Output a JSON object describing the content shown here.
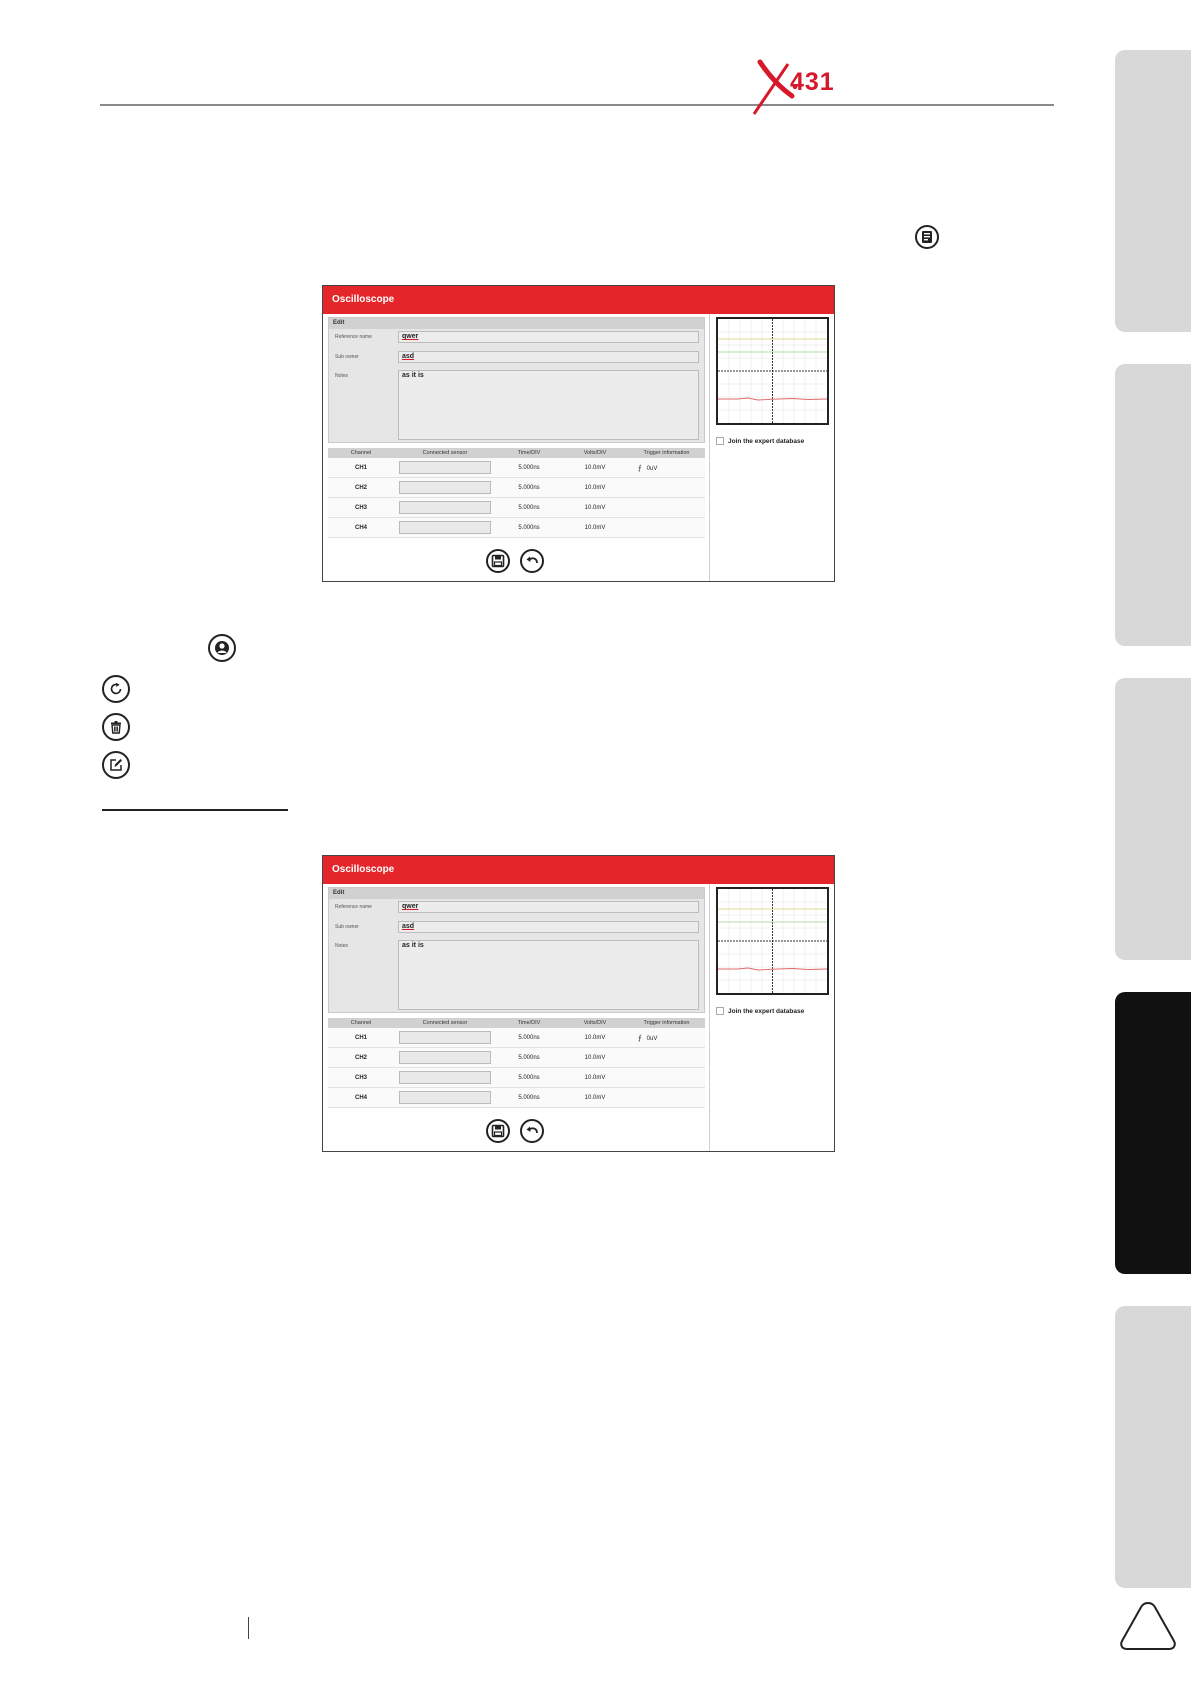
{
  "brand": {
    "logo_text": "431",
    "accent_color": "#d7182a"
  },
  "icons": {
    "header_icon": "notes-icon",
    "user_icon": "user-icon",
    "refresh_icon": "refresh-icon",
    "delete_icon": "trash-icon",
    "edit_icon": "edit-icon"
  },
  "screens": [
    {
      "title": "Oscilloscope",
      "edit": {
        "title": "Edit",
        "reference_name_label": "Reference name",
        "reference_name_value": "qwer",
        "sub_owner_label": "Sub owner",
        "sub_owner_value": "asd",
        "notes_label": "Notes",
        "notes_value": "as it is"
      },
      "table": {
        "headers": [
          "Channel",
          "Connected sensor",
          "Time/DIV",
          "Volts/DIV",
          "Trigger information"
        ],
        "rows": [
          {
            "channel": "CH1",
            "time_div": "5.000ns",
            "volts_div": "10.0mV",
            "trigger": "0uV"
          },
          {
            "channel": "CH2",
            "time_div": "5.000ns",
            "volts_div": "10.0mV",
            "trigger": ""
          },
          {
            "channel": "CH3",
            "time_div": "5.000ns",
            "volts_div": "10.0mV",
            "trigger": ""
          },
          {
            "channel": "CH4",
            "time_div": "5.000ns",
            "volts_div": "10.0mV",
            "trigger": ""
          }
        ]
      },
      "expert_checkbox_label": "Join the expert database"
    },
    {
      "title": "Oscilloscope",
      "edit": {
        "title": "Edit",
        "reference_name_label": "Reference name",
        "reference_name_value": "qwer",
        "sub_owner_label": "Sub owner",
        "sub_owner_value": "asd",
        "notes_label": "Notes",
        "notes_value": "as it is"
      },
      "table": {
        "headers": [
          "Channel",
          "Connected sensor",
          "Time/DIV",
          "Volts/DIV",
          "Trigger information"
        ],
        "rows": [
          {
            "channel": "CH1",
            "time_div": "5.000ns",
            "volts_div": "10.0mV",
            "trigger": "0uV"
          },
          {
            "channel": "CH2",
            "time_div": "5.000ns",
            "volts_div": "10.0mV",
            "trigger": ""
          },
          {
            "channel": "CH3",
            "time_div": "5.000ns",
            "volts_div": "10.0mV",
            "trigger": ""
          },
          {
            "channel": "CH4",
            "time_div": "5.000ns",
            "volts_div": "10.0mV",
            "trigger": ""
          }
        ]
      },
      "expert_checkbox_label": "Join the expert database"
    }
  ]
}
